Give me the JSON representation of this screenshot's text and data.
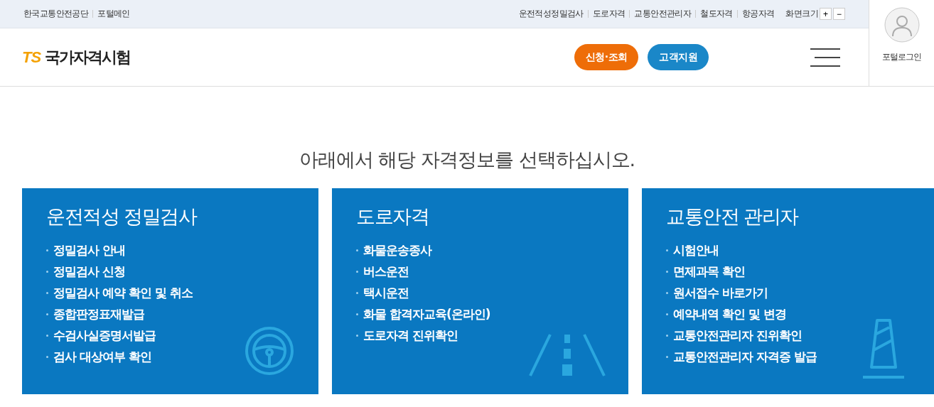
{
  "util_left": [
    "한국교통안전공단",
    "포털메인"
  ],
  "util_right": [
    "운전적성정밀검사",
    "도로자격",
    "교통안전관리자",
    "철도자격",
    "항공자격"
  ],
  "font_size": {
    "label": "화면크기",
    "plus": "+",
    "minus": "−"
  },
  "logo": {
    "mark": "TS",
    "title": "국가자격시험"
  },
  "header_buttons": [
    {
      "label": "신청·조회",
      "kind": "orange"
    },
    {
      "label": "고객지원",
      "kind": "blue"
    }
  ],
  "login": {
    "label": "포털로그인"
  },
  "heading": "아래에서 해당 자격정보를 선택하십시오.",
  "cards": [
    {
      "title": "운전적성 정밀검사",
      "kind": "wheel",
      "items": [
        "정밀검사 안내",
        "정밀검사 신청",
        "정밀검사 예약 확인 및 취소",
        "종합판정표재발급",
        "수검사실증명서발급",
        "검사 대상여부 확인"
      ]
    },
    {
      "title": "도로자격",
      "kind": "road",
      "items": [
        "화물운송종사",
        "버스운전",
        "택시운전",
        "화물 합격자교육(온라인)",
        "도로자격 진위확인"
      ]
    },
    {
      "title": "교통안전 관리자",
      "kind": "cone",
      "items": [
        "시험안내",
        "면제과목 확인",
        "원서접수 바로가기",
        "예약내역 확인 및 변경",
        "교통안전관리자 진위확인",
        "교통안전관리자 자격증 발급"
      ]
    }
  ]
}
